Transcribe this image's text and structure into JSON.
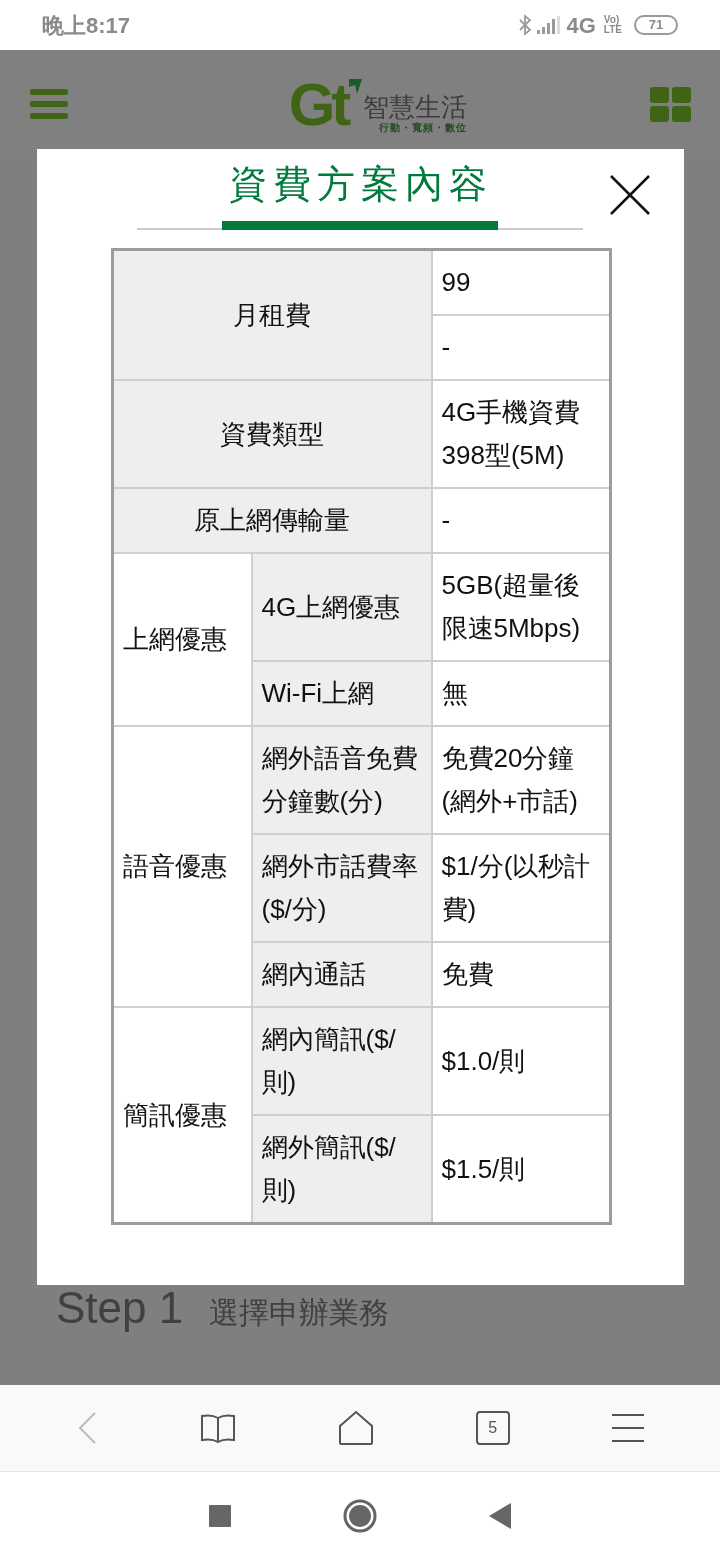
{
  "status_bar": {
    "time": "晚上8:17",
    "network": "4G",
    "volte": [
      "Vo)",
      "LTE"
    ],
    "battery": "71"
  },
  "header": {
    "logo_mark": "Gt",
    "logo_name": "智慧生活",
    "logo_tagline": "行動・寬頻・數位"
  },
  "page": {
    "step_number": "Step 1",
    "step_title": "選擇申辦業務"
  },
  "modal": {
    "title": "資費方案內容",
    "sections": [
      {
        "kind": "single",
        "label": "月租費",
        "values": [
          "99",
          "-"
        ]
      },
      {
        "kind": "single",
        "label": "資費類型",
        "values": [
          "4G手機資費398型(5M)"
        ]
      },
      {
        "kind": "single",
        "label": "原上網傳輸量",
        "values": [
          "-"
        ]
      },
      {
        "kind": "group",
        "label": "上網優惠",
        "items": [
          {
            "label": "4G上網優惠",
            "value": "5GB(超量後限速5Mbps)"
          },
          {
            "label": "Wi-Fi上網",
            "value": "無"
          }
        ]
      },
      {
        "kind": "group",
        "label": "語音優惠",
        "items": [
          {
            "label": "網外語音免費分鐘數(分)",
            "value": "免費20分鐘(網外+市話)"
          },
          {
            "label": "網外市話費率($/分)",
            "value": "$1/分(以秒計費)"
          },
          {
            "label": "網內通話",
            "value": "免費"
          }
        ]
      },
      {
        "kind": "group",
        "label": "簡訊優惠",
        "items": [
          {
            "label": "網內簡訊($/則)",
            "value": "$1.0/則"
          },
          {
            "label": "網外簡訊($/則)",
            "value": "$1.5/則"
          }
        ]
      }
    ]
  },
  "browser_bar": {
    "tab_count": "5"
  }
}
